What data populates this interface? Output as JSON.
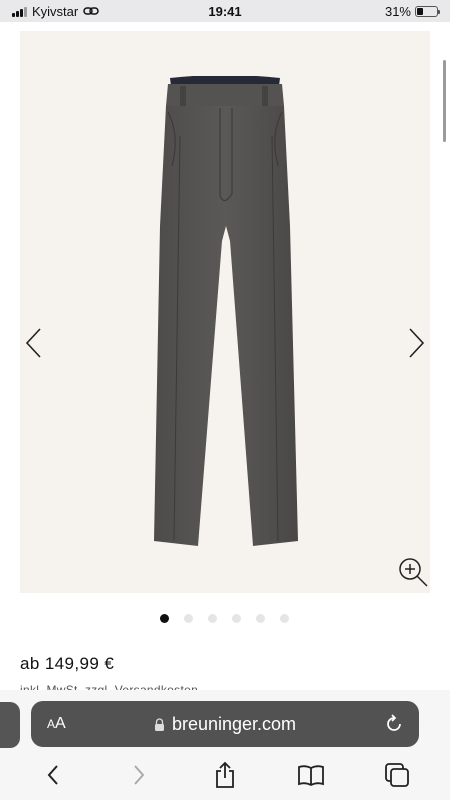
{
  "status_bar": {
    "carrier": "Kyivstar",
    "time": "19:41",
    "battery": "31%",
    "battery_level": 0.31
  },
  "product": {
    "image_alt": "grey trousers",
    "price": "ab 149,99 €",
    "price_note": "inkl. MwSt. zzgl. Versandkosten",
    "carousel": {
      "total": 6,
      "active_index": 0
    }
  },
  "browser": {
    "aa_label": "AA",
    "url": "breuninger.com"
  },
  "icons": {
    "prev": "chevron-left-icon",
    "next": "chevron-right-icon",
    "zoom": "zoom-in-icon",
    "reload": "reload-icon",
    "back": "back-icon",
    "forward": "forward-icon",
    "share": "share-icon",
    "bookmarks": "book-icon",
    "tabs": "tabs-icon"
  }
}
